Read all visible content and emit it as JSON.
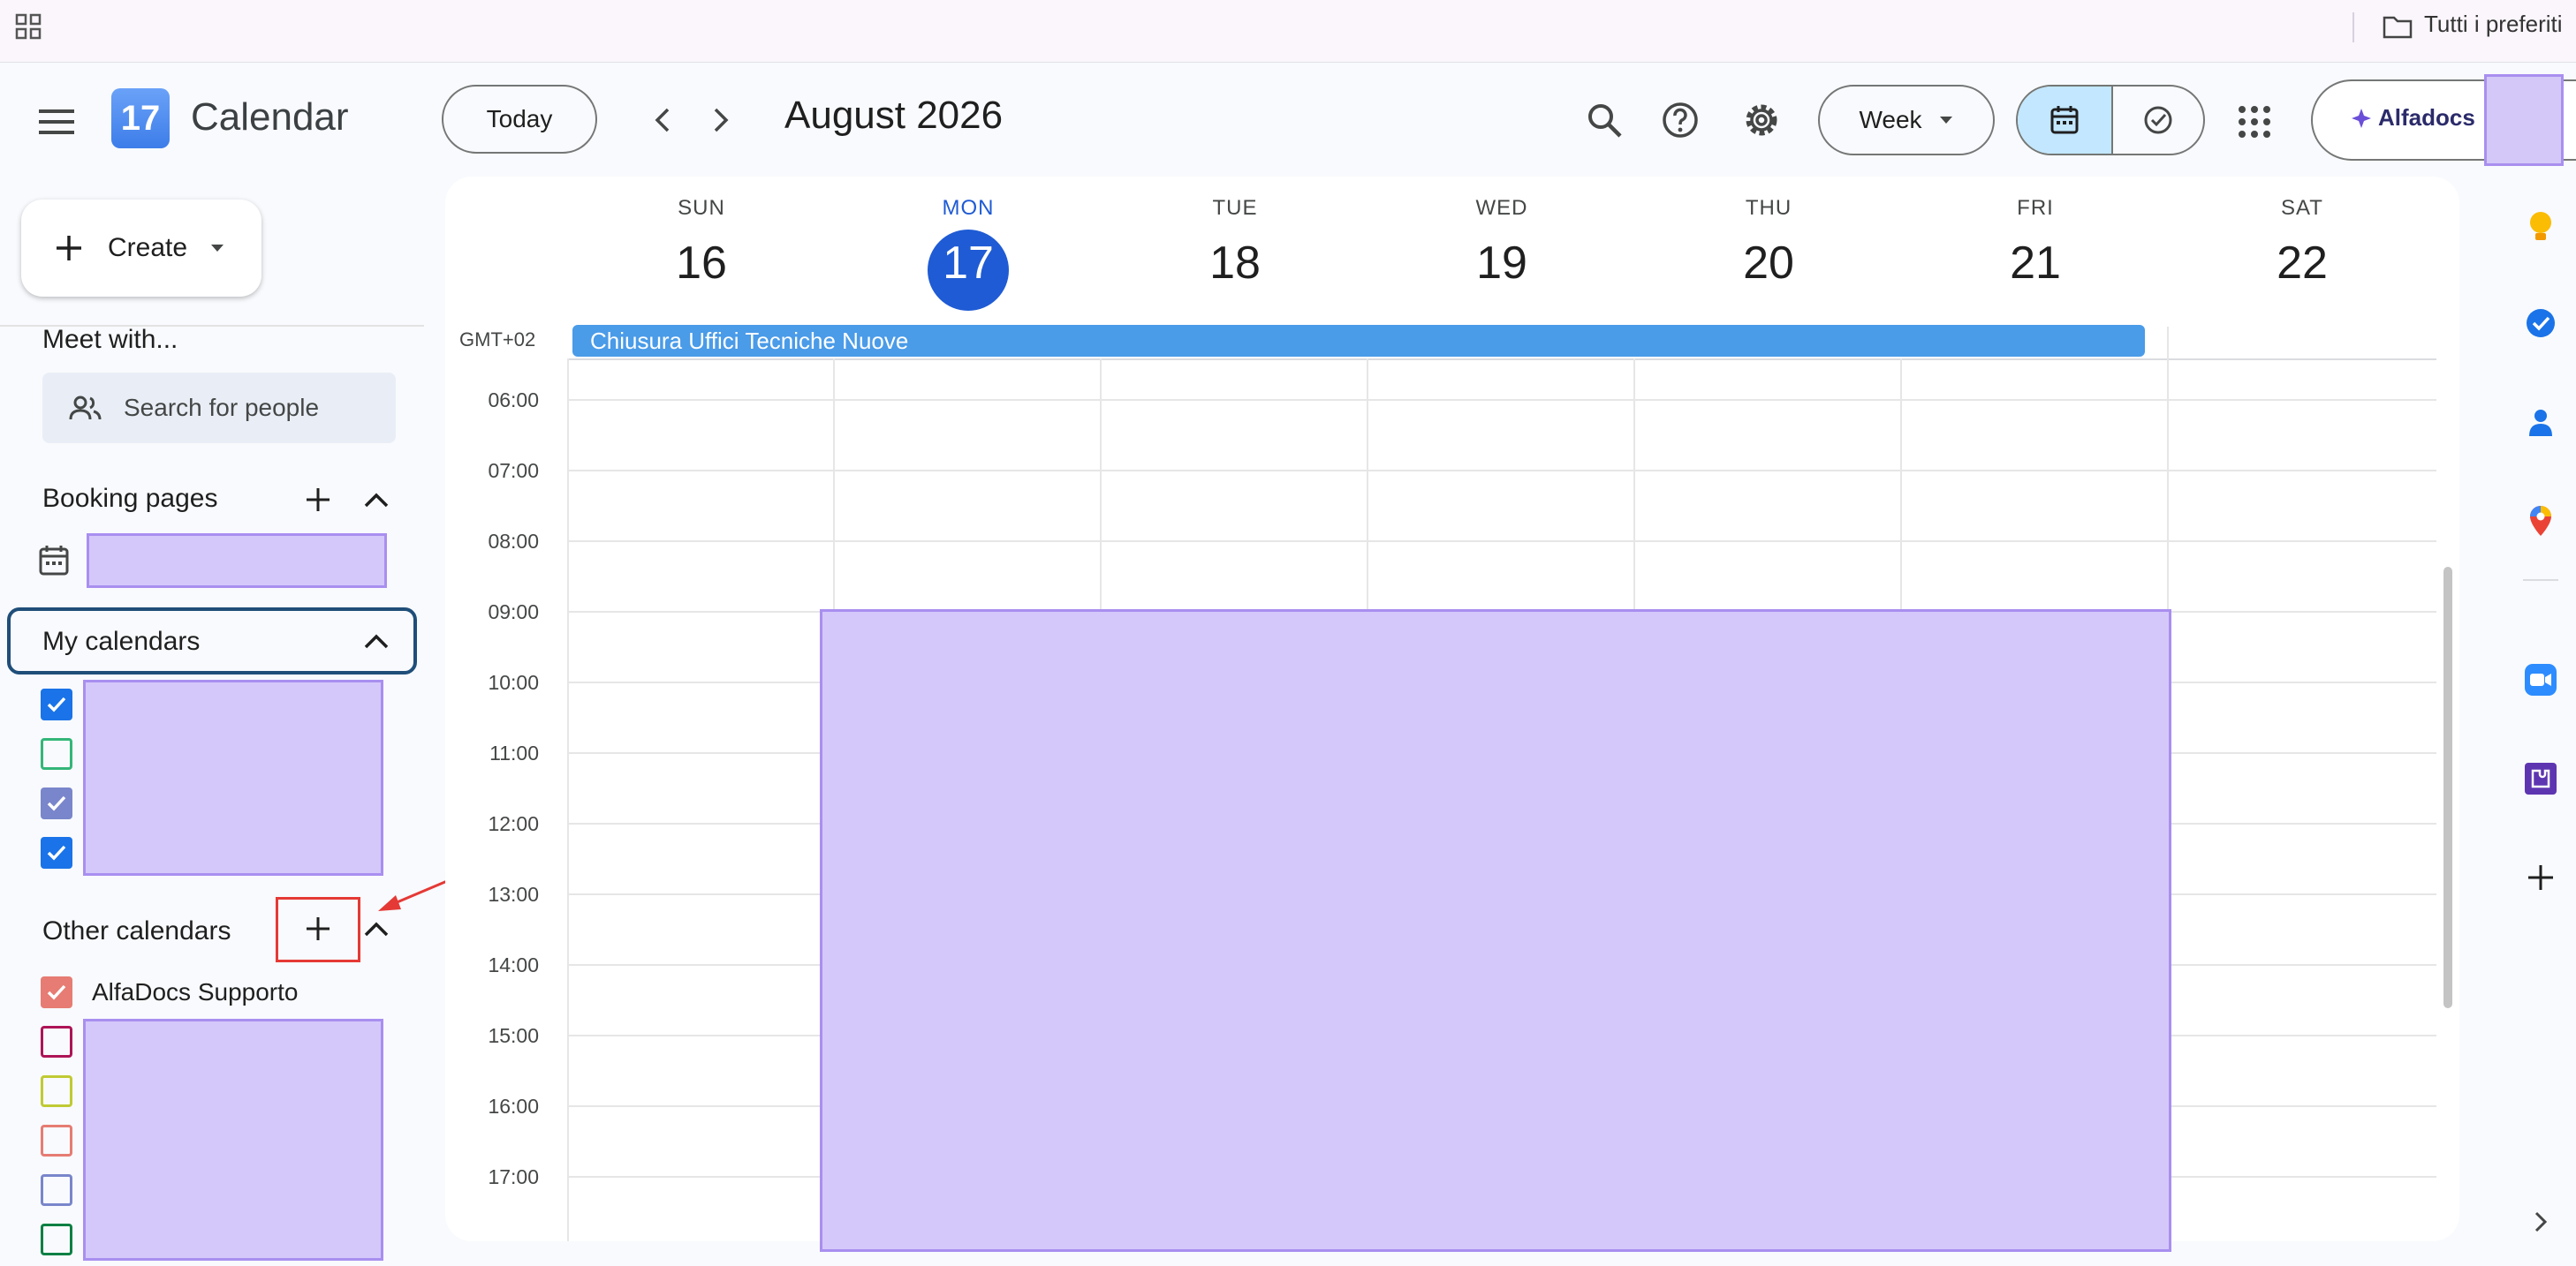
{
  "bookmarks": {
    "folder_label": "Tutti i preferiti"
  },
  "header": {
    "app_title": "Calendar",
    "logo_day": "17",
    "today_label": "Today",
    "period": "August 2026",
    "view_label": "Week",
    "account_brand": "Alfadocs"
  },
  "sidebar": {
    "create_label": "Create",
    "meet_with": "Meet with...",
    "search_people_placeholder": "Search for people",
    "booking_pages": "Booking pages",
    "my_calendars": "My calendars",
    "other_calendars": "Other calendars",
    "other_calendar_items": [
      "AlfaDocs Supporto"
    ]
  },
  "week": {
    "days": [
      {
        "name": "SUN",
        "num": "16"
      },
      {
        "name": "MON",
        "num": "17"
      },
      {
        "name": "TUE",
        "num": "18"
      },
      {
        "name": "WED",
        "num": "19"
      },
      {
        "name": "THU",
        "num": "20"
      },
      {
        "name": "FRI",
        "num": "21"
      },
      {
        "name": "SAT",
        "num": "22"
      }
    ],
    "timezone": "GMT+02",
    "all_day_event": "Chiusura Uffici Tecniche Nuove",
    "times": [
      "06:00",
      "07:00",
      "08:00",
      "09:00",
      "10:00",
      "11:00",
      "12:00",
      "13:00",
      "14:00",
      "15:00",
      "16:00",
      "17:00"
    ]
  },
  "colors": {
    "accent": "#1f5bd4",
    "event": "#4a9be8",
    "redacted": "#d4c8fa",
    "highlight_red": "#e53935"
  }
}
